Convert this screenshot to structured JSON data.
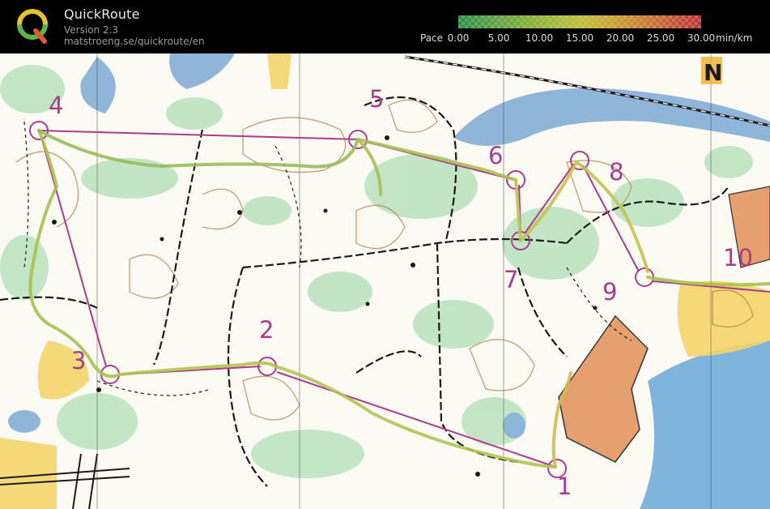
{
  "app": {
    "name": "QuickRoute",
    "version": "Version 2.3",
    "url": "matstroeng.se/quickroute/en"
  },
  "pace_legend": {
    "label": "Pace",
    "ticks": [
      "0.00",
      "5.00",
      "10.00",
      "15.00",
      "20.00",
      "25.00",
      "30.00"
    ],
    "unit": "min/km",
    "range_min_per_km": [
      0,
      30
    ],
    "colors": [
      "#2aa84a",
      "#e4e23a",
      "#e03a3a"
    ]
  },
  "map": {
    "north_arrow_symbol": "N",
    "course_color": "#b03a8a",
    "route_color": "#8aa84a",
    "controls": [
      {
        "id": "1",
        "label": "1"
      },
      {
        "id": "2",
        "label": "2"
      },
      {
        "id": "3",
        "label": "3"
      },
      {
        "id": "4",
        "label": "4"
      },
      {
        "id": "5",
        "label": "5"
      },
      {
        "id": "6",
        "label": "6"
      },
      {
        "id": "7",
        "label": "7"
      },
      {
        "id": "8",
        "label": "8"
      },
      {
        "id": "9",
        "label": "9"
      },
      {
        "id": "10",
        "label": "10"
      }
    ]
  }
}
